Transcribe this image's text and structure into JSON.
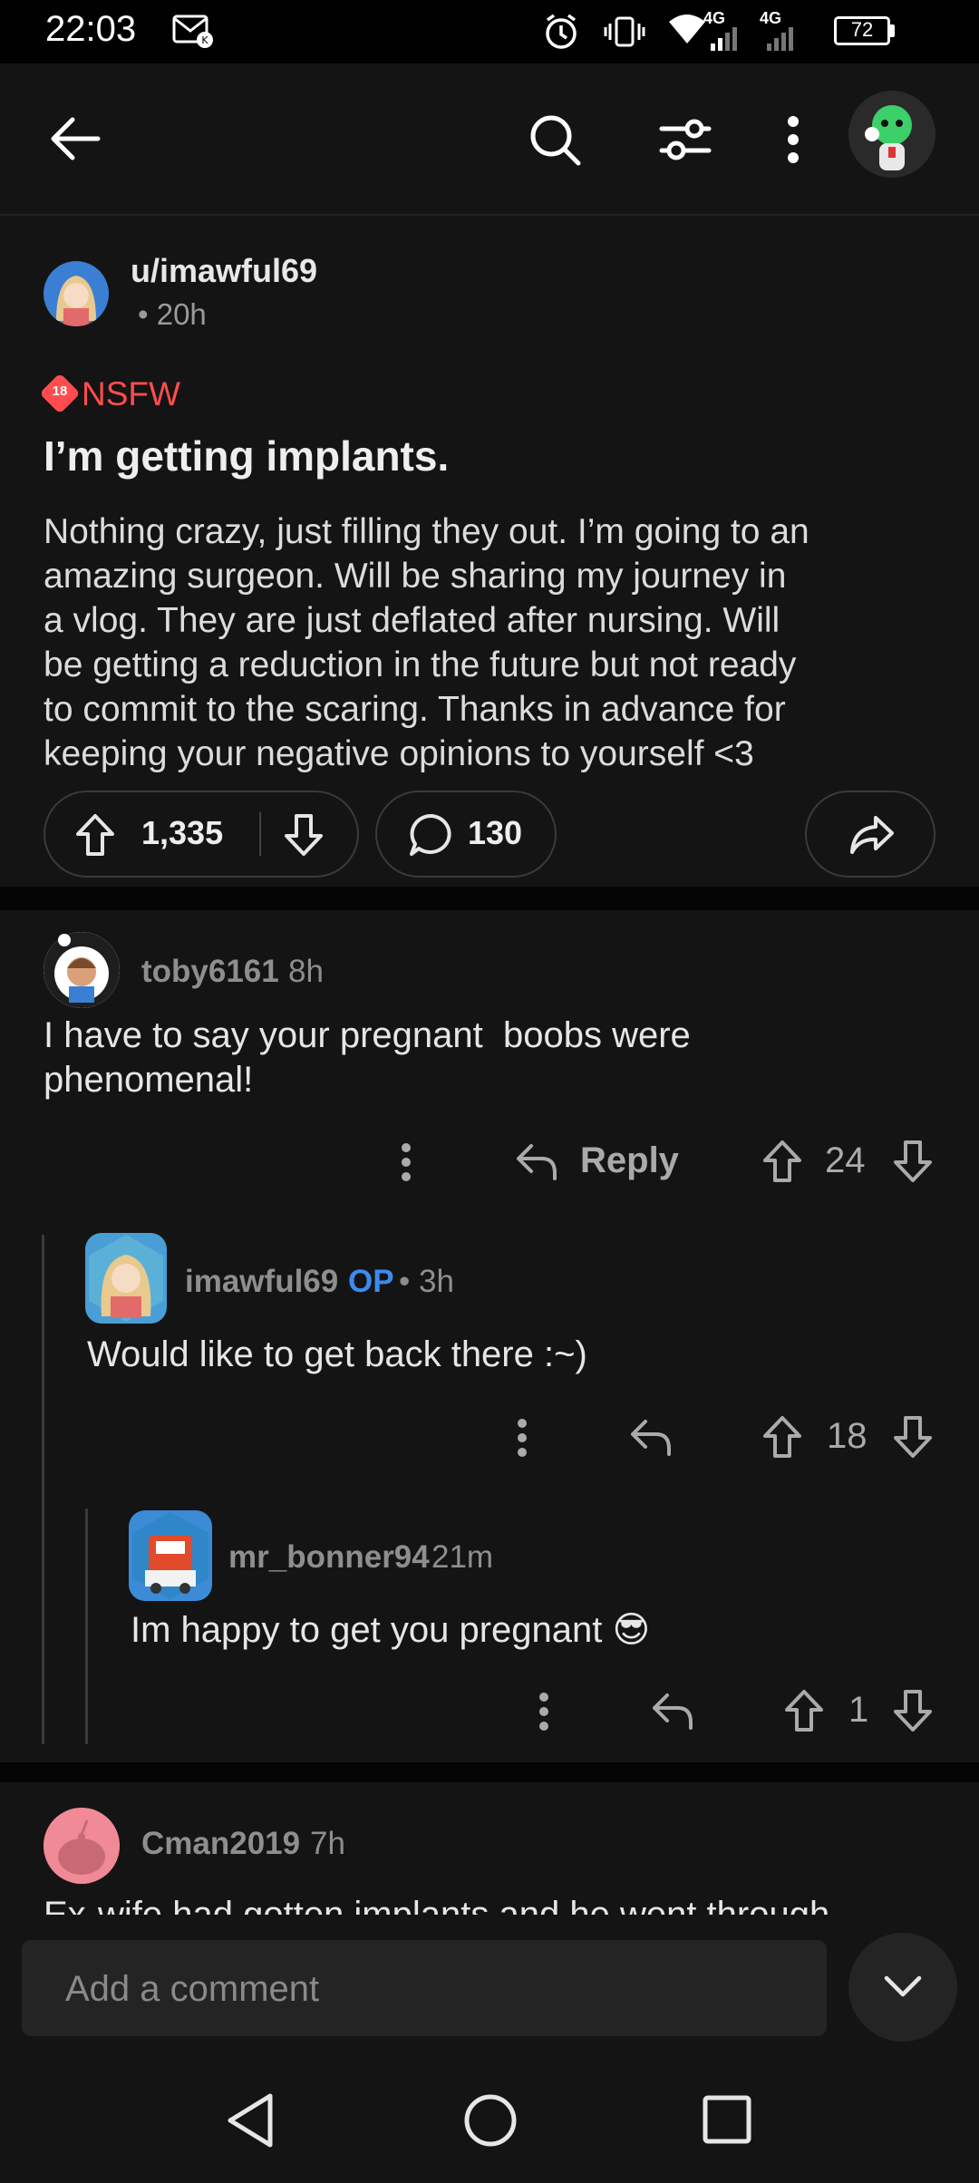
{
  "status_bar": {
    "time": "22:03",
    "network1": "4G",
    "network2": "4G",
    "battery": "72"
  },
  "post": {
    "author": "u/imawful69",
    "age": "• 20h",
    "nsfw_badge": "18",
    "nsfw_label": "NSFW",
    "title": "I’m getting implants.",
    "body_lines": [
      "Nothing crazy, just filling they out. I’m going to an",
      "amazing surgeon. Will be sharing my journey in",
      "a vlog. They are just deflated after nursing. Will",
      "be getting a reduction in the future but not ready",
      "to commit to the scaring. Thanks in advance for",
      "keeping your negative opinions to yourself <3"
    ],
    "upvotes": "1,335",
    "comments": "130"
  },
  "comments": [
    {
      "user": "toby6161",
      "time": "8h",
      "text_lines": [
        "I have to say your pregnant  boobs were",
        "phenomenal!"
      ],
      "reply_label": "Reply",
      "score": "24"
    },
    {
      "user": "imawful69",
      "op_badge": "OP",
      "time": "• 3h",
      "text_lines": [
        "Would like to get back there :~)"
      ],
      "score": "18"
    },
    {
      "user": "mr_bonner94",
      "time": "21m",
      "text_lines": [
        "Im happy to get you pregnant 😎"
      ],
      "score": "1"
    },
    {
      "user": "Cman2019",
      "time": "7h",
      "text_lines": [
        "Ex-wife had gotten implants and he went through"
      ]
    }
  ],
  "comment_input": {
    "placeholder": "Add a comment"
  },
  "colors": {
    "background": "#141414",
    "nsfw": "#ff4d4f",
    "op_badge": "#3b8bef",
    "avatar_cman": "#f08a96"
  },
  "icons": [
    "back-arrow-icon",
    "search-icon",
    "filter-icon",
    "more-vertical-icon",
    "upvote-icon",
    "downvote-icon",
    "comment-bubble-icon",
    "share-icon",
    "reply-icon",
    "chevron-down-icon",
    "nav-back-icon",
    "nav-home-icon",
    "nav-recents-icon"
  ]
}
